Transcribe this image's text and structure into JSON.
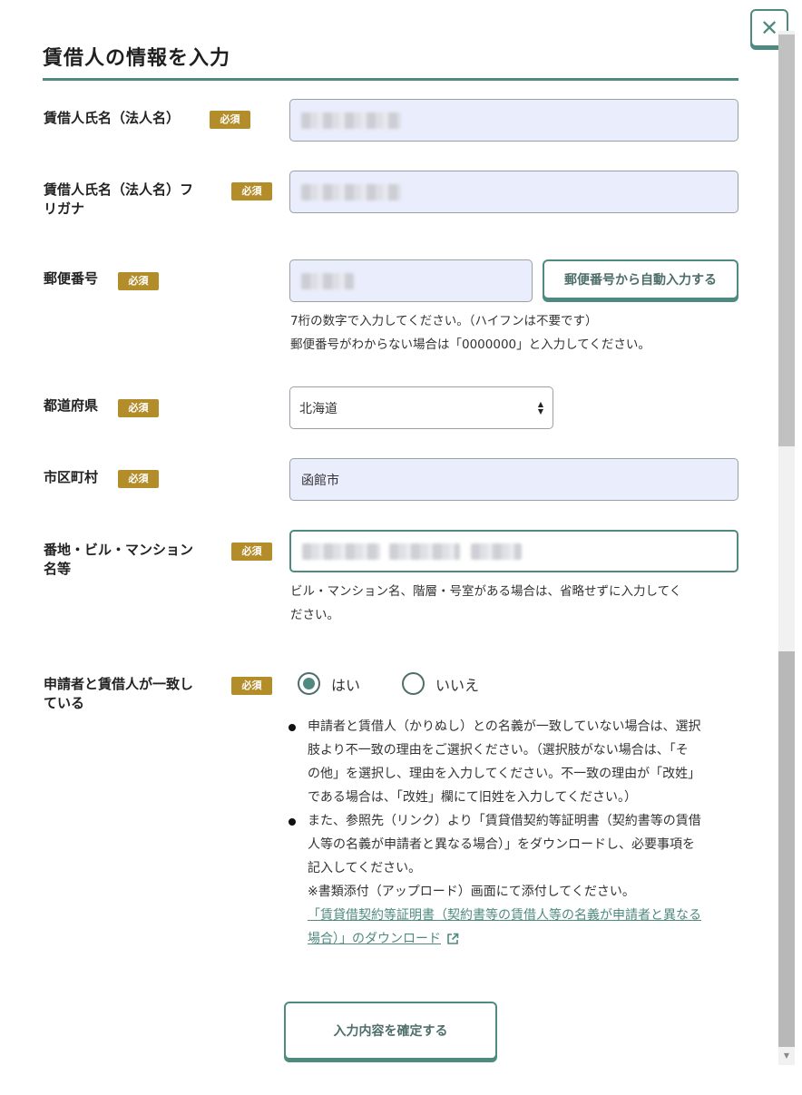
{
  "dialog": {
    "title": "賃借人の情報を入力",
    "close_label": "✕"
  },
  "required_badge": "必須",
  "fields": {
    "name": {
      "label": "賃借人氏名（法人名）"
    },
    "furigana": {
      "label_line1": "賃借人氏名（法人名）フ",
      "label_line2": "リガナ"
    },
    "postal": {
      "label": "郵便番号",
      "autofill_button": "郵便番号から自動入力する",
      "help_line1": "7桁の数字で入力してください。（ハイフンは不要です）",
      "help_line2": "郵便番号がわからない場合は「0000000」と入力してください。"
    },
    "prefecture": {
      "label": "都道府県",
      "selected": "北海道"
    },
    "city": {
      "label": "市区町村",
      "value": "函館市"
    },
    "address": {
      "label_line1": "番地・ビル・マンション",
      "label_line2": "名等",
      "help_line1": "ビル・マンション名、階層・号室がある場合は、省略せずに入力してく",
      "help_line2": "ださい。"
    },
    "match": {
      "label_line1": "申請者と賃借人が一致し",
      "label_line2": "ている",
      "options": [
        {
          "label": "はい",
          "selected": true
        },
        {
          "label": "いいえ",
          "selected": false
        }
      ],
      "note1_lines": [
        "申請者と賃借人（かりぬし）との名義が一致していない場合は、選択",
        "肢より不一致の理由をご選択ください。（選択肢がない場合は、「そ",
        "の他」を選択し、理由を入力してください。不一致の理由が「改姓」",
        "である場合は、「改姓」欄にて旧姓を入力してください。）"
      ],
      "note2_lines": [
        "また、参照先（リンク）より「賃貸借契約等証明書（契約書等の賃借",
        "人等の名義が申請者と異なる場合）」をダウンロードし、必要事項を",
        "記入してください。",
        "※書類添付（アップロード）画面にて添付してください。"
      ],
      "link_line1": "「賃貸借契約等証明書（契約書等の賃借人等の名義が申請者と異なる",
      "link_line2": "場合）」のダウンロード"
    }
  },
  "submit_button": "入力内容を確定する",
  "colors": {
    "accent": "#4e8a80",
    "badge": "#b48d2b",
    "input_bg": "#eaedfb"
  }
}
